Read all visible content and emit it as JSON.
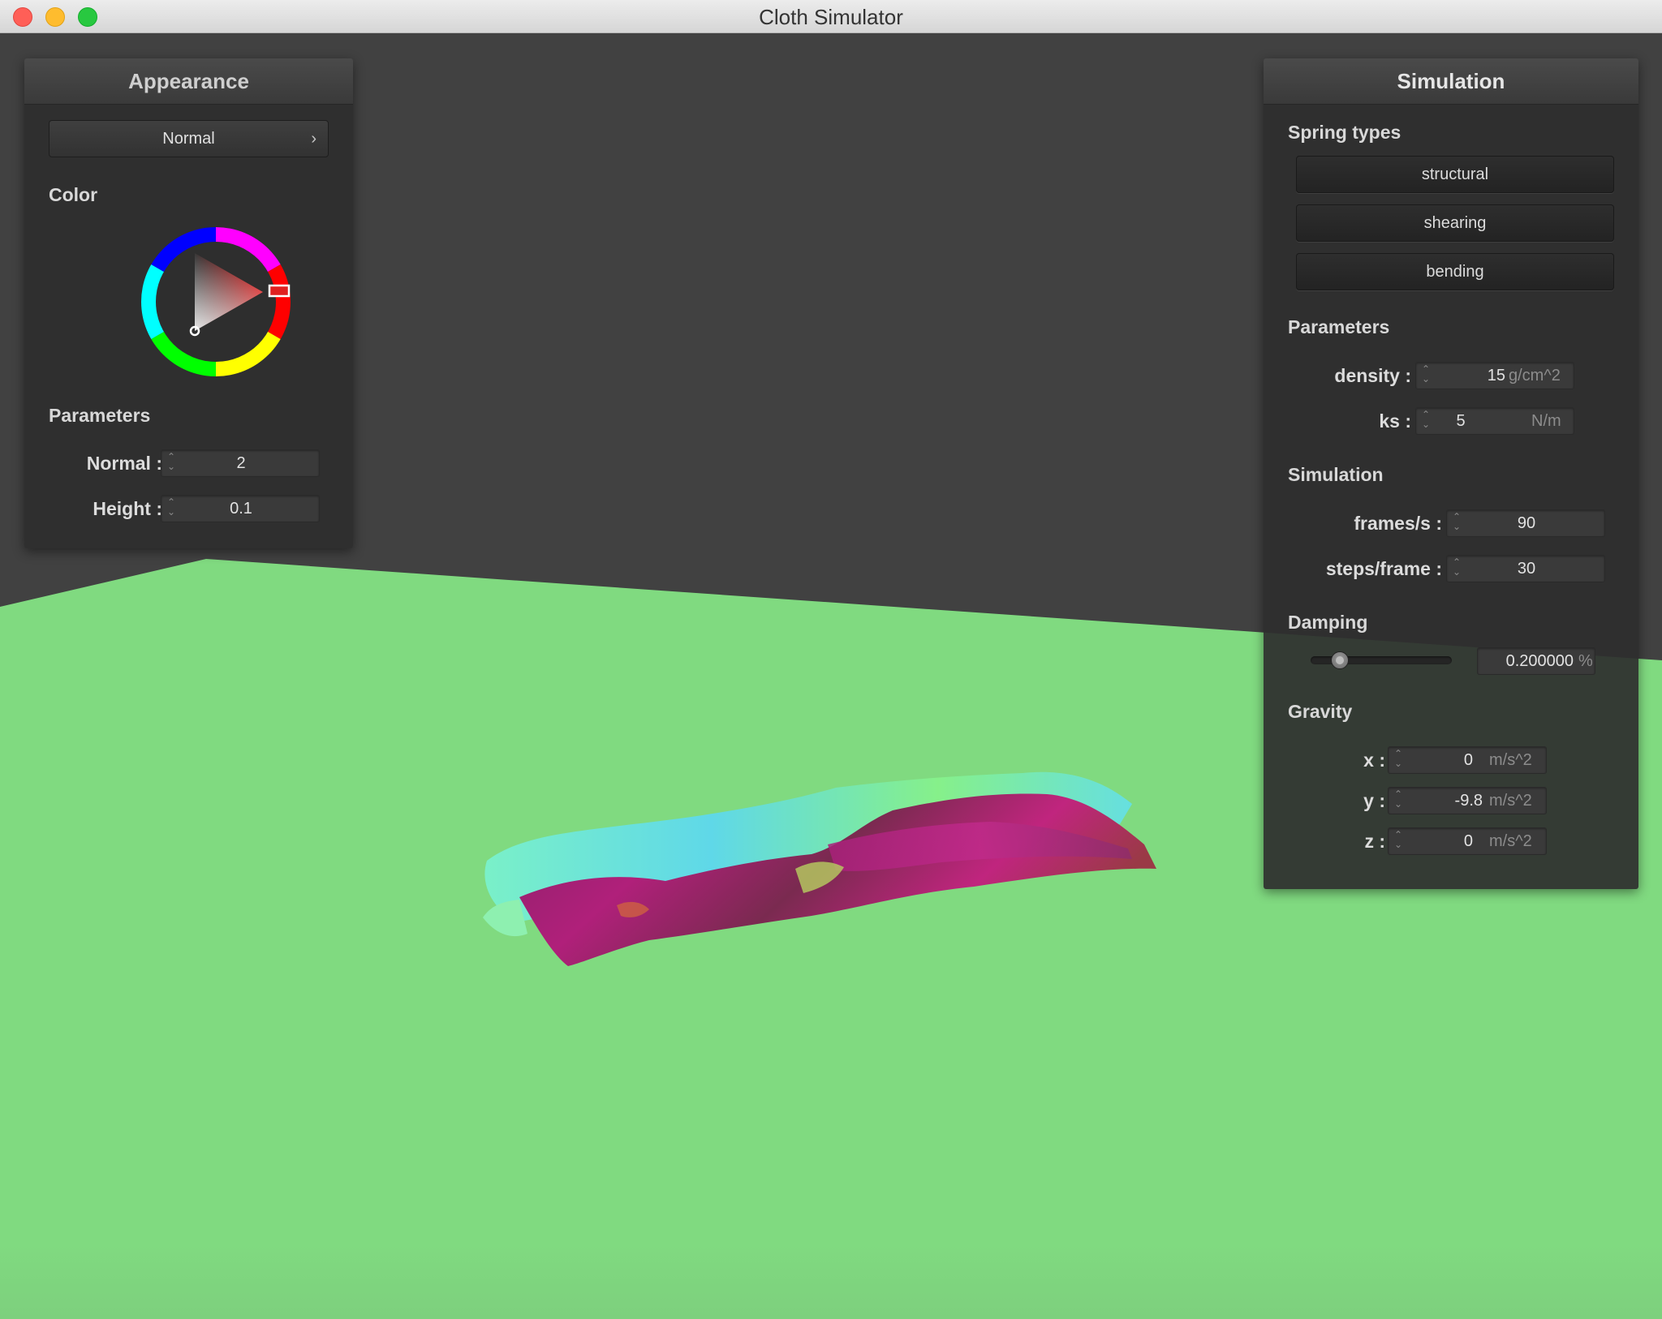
{
  "window": {
    "title": "Cloth Simulator"
  },
  "colors": {
    "ground": "#80da80",
    "background": "#414141",
    "selected_color": "#e02020"
  },
  "appearance": {
    "title": "Appearance",
    "shader_select": {
      "value": "Normal"
    },
    "color_label": "Color",
    "parameters_label": "Parameters",
    "normal": {
      "label": "Normal :",
      "value": "2"
    },
    "height": {
      "label": "Height :",
      "value": "0.1"
    }
  },
  "simulation_panel": {
    "title": "Simulation",
    "spring_types_label": "Spring types",
    "spring_buttons": [
      "structural",
      "shearing",
      "bending"
    ],
    "parameters_label": "Parameters",
    "density": {
      "label": "density :",
      "value": "15",
      "unit": "g/cm^2"
    },
    "ks": {
      "label": "ks :",
      "value": "5",
      "unit": "N/m"
    },
    "simulation_label": "Simulation",
    "frames_per_sec": {
      "label": "frames/s :",
      "value": "90"
    },
    "steps_per_frame": {
      "label": "steps/frame :",
      "value": "30"
    },
    "damping_label": "Damping",
    "damping": {
      "value": "0.200000",
      "unit": "%",
      "slider_fraction": 0.2
    },
    "gravity_label": "Gravity",
    "gravity": {
      "x": {
        "label": "x :",
        "value": "0",
        "unit": "m/s^2"
      },
      "y": {
        "label": "y :",
        "value": "-9.8",
        "unit": "m/s^2"
      },
      "z": {
        "label": "z :",
        "value": "0",
        "unit": "m/s^2"
      }
    }
  }
}
